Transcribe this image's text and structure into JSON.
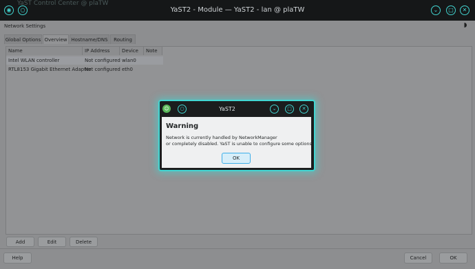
{
  "window": {
    "title": "YaST2 - Module — YaST2 - lan @ plaTW",
    "background_title": "YaST Control Center @ plaTW",
    "heading": "Network Settings"
  },
  "tabs": [
    {
      "label": "Global Options"
    },
    {
      "label": "Overview"
    },
    {
      "label": "Hostname/DNS"
    },
    {
      "label": "Routing"
    }
  ],
  "table": {
    "columns": [
      "Name",
      "IP Address",
      "Device",
      "Note"
    ],
    "rows": [
      {
        "name": "Intel WLAN controller",
        "ip": "Not configured",
        "device": "wlan0",
        "note": ""
      },
      {
        "name": "RTL8153 Gigabit Ethernet Adapter",
        "ip": "Not configured",
        "device": "eth0",
        "note": ""
      }
    ]
  },
  "actions": {
    "add": "Add",
    "edit": "Edit",
    "delete": "Delete"
  },
  "footer": {
    "help": "Help",
    "cancel": "Cancel",
    "ok": "OK"
  },
  "dialog": {
    "title": "YaST2",
    "heading": "Warning",
    "message_line1": "Network is currently handled by NetworkManager",
    "message_line2": "or completely disabled. YaST is unable to configure some options.",
    "ok": "OK"
  },
  "icons": {
    "menu": "circle-menu-icon",
    "minimize": "chevron-down-icon",
    "maximize": "square-icon",
    "close": "close-icon",
    "theme": "half-moon-icon",
    "dialog_app": "yast-chameleon-icon"
  },
  "colors": {
    "accent": "#42d6d2",
    "titlebar": "#151718",
    "dimmed": "#8d8e90"
  }
}
